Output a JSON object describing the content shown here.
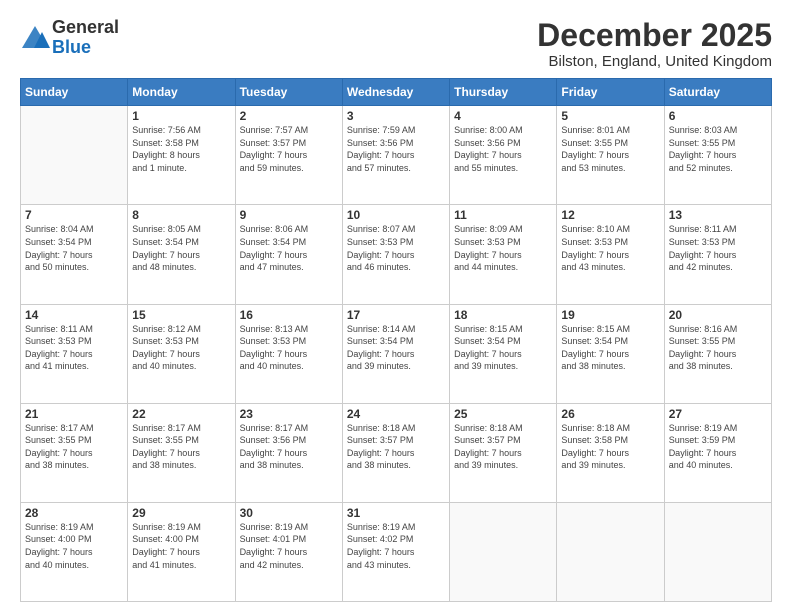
{
  "logo": {
    "general": "General",
    "blue": "Blue"
  },
  "header": {
    "month": "December 2025",
    "location": "Bilston, England, United Kingdom"
  },
  "weekdays": [
    "Sunday",
    "Monday",
    "Tuesday",
    "Wednesday",
    "Thursday",
    "Friday",
    "Saturday"
  ],
  "weeks": [
    [
      {
        "day": "",
        "info": ""
      },
      {
        "day": "1",
        "info": "Sunrise: 7:56 AM\nSunset: 3:58 PM\nDaylight: 8 hours\nand 1 minute."
      },
      {
        "day": "2",
        "info": "Sunrise: 7:57 AM\nSunset: 3:57 PM\nDaylight: 7 hours\nand 59 minutes."
      },
      {
        "day": "3",
        "info": "Sunrise: 7:59 AM\nSunset: 3:56 PM\nDaylight: 7 hours\nand 57 minutes."
      },
      {
        "day": "4",
        "info": "Sunrise: 8:00 AM\nSunset: 3:56 PM\nDaylight: 7 hours\nand 55 minutes."
      },
      {
        "day": "5",
        "info": "Sunrise: 8:01 AM\nSunset: 3:55 PM\nDaylight: 7 hours\nand 53 minutes."
      },
      {
        "day": "6",
        "info": "Sunrise: 8:03 AM\nSunset: 3:55 PM\nDaylight: 7 hours\nand 52 minutes."
      }
    ],
    [
      {
        "day": "7",
        "info": "Sunrise: 8:04 AM\nSunset: 3:54 PM\nDaylight: 7 hours\nand 50 minutes."
      },
      {
        "day": "8",
        "info": "Sunrise: 8:05 AM\nSunset: 3:54 PM\nDaylight: 7 hours\nand 48 minutes."
      },
      {
        "day": "9",
        "info": "Sunrise: 8:06 AM\nSunset: 3:54 PM\nDaylight: 7 hours\nand 47 minutes."
      },
      {
        "day": "10",
        "info": "Sunrise: 8:07 AM\nSunset: 3:53 PM\nDaylight: 7 hours\nand 46 minutes."
      },
      {
        "day": "11",
        "info": "Sunrise: 8:09 AM\nSunset: 3:53 PM\nDaylight: 7 hours\nand 44 minutes."
      },
      {
        "day": "12",
        "info": "Sunrise: 8:10 AM\nSunset: 3:53 PM\nDaylight: 7 hours\nand 43 minutes."
      },
      {
        "day": "13",
        "info": "Sunrise: 8:11 AM\nSunset: 3:53 PM\nDaylight: 7 hours\nand 42 minutes."
      }
    ],
    [
      {
        "day": "14",
        "info": "Sunrise: 8:11 AM\nSunset: 3:53 PM\nDaylight: 7 hours\nand 41 minutes."
      },
      {
        "day": "15",
        "info": "Sunrise: 8:12 AM\nSunset: 3:53 PM\nDaylight: 7 hours\nand 40 minutes."
      },
      {
        "day": "16",
        "info": "Sunrise: 8:13 AM\nSunset: 3:53 PM\nDaylight: 7 hours\nand 40 minutes."
      },
      {
        "day": "17",
        "info": "Sunrise: 8:14 AM\nSunset: 3:54 PM\nDaylight: 7 hours\nand 39 minutes."
      },
      {
        "day": "18",
        "info": "Sunrise: 8:15 AM\nSunset: 3:54 PM\nDaylight: 7 hours\nand 39 minutes."
      },
      {
        "day": "19",
        "info": "Sunrise: 8:15 AM\nSunset: 3:54 PM\nDaylight: 7 hours\nand 38 minutes."
      },
      {
        "day": "20",
        "info": "Sunrise: 8:16 AM\nSunset: 3:55 PM\nDaylight: 7 hours\nand 38 minutes."
      }
    ],
    [
      {
        "day": "21",
        "info": "Sunrise: 8:17 AM\nSunset: 3:55 PM\nDaylight: 7 hours\nand 38 minutes."
      },
      {
        "day": "22",
        "info": "Sunrise: 8:17 AM\nSunset: 3:55 PM\nDaylight: 7 hours\nand 38 minutes."
      },
      {
        "day": "23",
        "info": "Sunrise: 8:17 AM\nSunset: 3:56 PM\nDaylight: 7 hours\nand 38 minutes."
      },
      {
        "day": "24",
        "info": "Sunrise: 8:18 AM\nSunset: 3:57 PM\nDaylight: 7 hours\nand 38 minutes."
      },
      {
        "day": "25",
        "info": "Sunrise: 8:18 AM\nSunset: 3:57 PM\nDaylight: 7 hours\nand 39 minutes."
      },
      {
        "day": "26",
        "info": "Sunrise: 8:18 AM\nSunset: 3:58 PM\nDaylight: 7 hours\nand 39 minutes."
      },
      {
        "day": "27",
        "info": "Sunrise: 8:19 AM\nSunset: 3:59 PM\nDaylight: 7 hours\nand 40 minutes."
      }
    ],
    [
      {
        "day": "28",
        "info": "Sunrise: 8:19 AM\nSunset: 4:00 PM\nDaylight: 7 hours\nand 40 minutes."
      },
      {
        "day": "29",
        "info": "Sunrise: 8:19 AM\nSunset: 4:00 PM\nDaylight: 7 hours\nand 41 minutes."
      },
      {
        "day": "30",
        "info": "Sunrise: 8:19 AM\nSunset: 4:01 PM\nDaylight: 7 hours\nand 42 minutes."
      },
      {
        "day": "31",
        "info": "Sunrise: 8:19 AM\nSunset: 4:02 PM\nDaylight: 7 hours\nand 43 minutes."
      },
      {
        "day": "",
        "info": ""
      },
      {
        "day": "",
        "info": ""
      },
      {
        "day": "",
        "info": ""
      }
    ]
  ]
}
